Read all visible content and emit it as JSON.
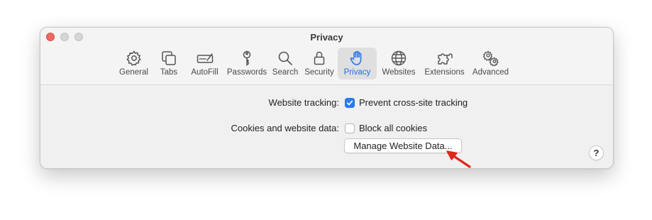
{
  "window": {
    "title": "Privacy"
  },
  "toolbar": {
    "tabs": [
      {
        "label": "General",
        "icon": "gear-icon"
      },
      {
        "label": "Tabs",
        "icon": "tabs-icon"
      },
      {
        "label": "AutoFill",
        "icon": "autofill-icon"
      },
      {
        "label": "Passwords",
        "icon": "key-icon"
      },
      {
        "label": "Search",
        "icon": "search-icon"
      },
      {
        "label": "Security",
        "icon": "lock-icon"
      },
      {
        "label": "Privacy",
        "icon": "hand-icon"
      },
      {
        "label": "Websites",
        "icon": "globe-icon"
      },
      {
        "label": "Extensions",
        "icon": "puzzle-icon"
      },
      {
        "label": "Advanced",
        "icon": "gears-icon"
      }
    ],
    "active_tab": "Privacy"
  },
  "settings": {
    "tracking_label": "Website tracking:",
    "tracking_option": "Prevent cross-site tracking",
    "tracking_checked": true,
    "cookies_label": "Cookies and website data:",
    "cookies_option": "Block all cookies",
    "cookies_checked": false,
    "manage_button": "Manage Website Data..."
  },
  "help_label": "?",
  "colors": {
    "accent": "#2d7cf6",
    "annotation_arrow": "#e0261b",
    "close": "#ed6a5e"
  }
}
